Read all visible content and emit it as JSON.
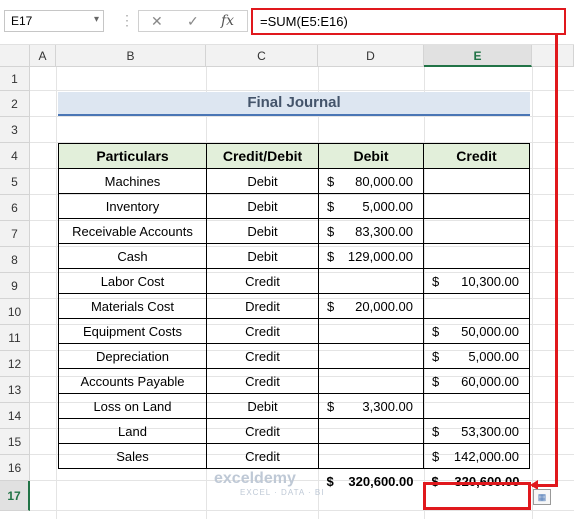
{
  "formula_bar": {
    "name_box": "E17",
    "cancel_icon": "✕",
    "enter_icon": "✓",
    "fx_label": "fx",
    "formula": "=SUM(E5:E16)"
  },
  "columns": [
    "A",
    "B",
    "C",
    "D",
    "E"
  ],
  "rows": [
    "1",
    "2",
    "3",
    "4",
    "5",
    "6",
    "7",
    "8",
    "9",
    "10",
    "11",
    "12",
    "13",
    "14",
    "15",
    "16",
    "17"
  ],
  "title": "Final Journal",
  "table": {
    "headers": [
      "Particulars",
      "Credit/Debit",
      "Debit",
      "Credit"
    ],
    "rows": [
      {
        "particular": "Machines",
        "type": "Debit",
        "debit_cur": "$",
        "debit": "80,000.00",
        "credit_cur": "",
        "credit": ""
      },
      {
        "particular": "Inventory",
        "type": "Debit",
        "debit_cur": "$",
        "debit": "5,000.00",
        "credit_cur": "",
        "credit": ""
      },
      {
        "particular": "Receivable Accounts",
        "type": "Debit",
        "debit_cur": "$",
        "debit": "83,300.00",
        "credit_cur": "",
        "credit": ""
      },
      {
        "particular": "Cash",
        "type": "Debit",
        "debit_cur": "$",
        "debit": "129,000.00",
        "credit_cur": "",
        "credit": ""
      },
      {
        "particular": "Labor Cost",
        "type": "Credit",
        "debit_cur": "",
        "debit": "",
        "credit_cur": "$",
        "credit": "10,300.00"
      },
      {
        "particular": "Materials Cost",
        "type": "Dredit",
        "debit_cur": "$",
        "debit": "20,000.00",
        "credit_cur": "",
        "credit": ""
      },
      {
        "particular": "Equipment Costs",
        "type": "Credit",
        "debit_cur": "",
        "debit": "",
        "credit_cur": "$",
        "credit": "50,000.00"
      },
      {
        "particular": "Depreciation",
        "type": "Credit",
        "debit_cur": "",
        "debit": "",
        "credit_cur": "$",
        "credit": "5,000.00"
      },
      {
        "particular": "Accounts Payable",
        "type": "Credit",
        "debit_cur": "",
        "debit": "",
        "credit_cur": "$",
        "credit": "60,000.00"
      },
      {
        "particular": "Loss on Land",
        "type": "Debit",
        "debit_cur": "$",
        "debit": "3,300.00",
        "credit_cur": "",
        "credit": ""
      },
      {
        "particular": "Land",
        "type": "Credit",
        "debit_cur": "",
        "debit": "",
        "credit_cur": "$",
        "credit": "53,300.00"
      },
      {
        "particular": "Sales",
        "type": "Credit",
        "debit_cur": "",
        "debit": "",
        "credit_cur": "$",
        "credit": "142,000.00"
      }
    ],
    "totals": {
      "debit_cur": "$",
      "debit": "320,600.00",
      "credit_cur": "$",
      "credit": "320,600.00"
    }
  },
  "watermark": {
    "brand": "exceldemy",
    "tagline": "EXCEL · DATA · BI"
  },
  "colors": {
    "highlight_red": "#e0181d",
    "header_green": "#e2efda",
    "title_fill": "#dde6f1"
  }
}
